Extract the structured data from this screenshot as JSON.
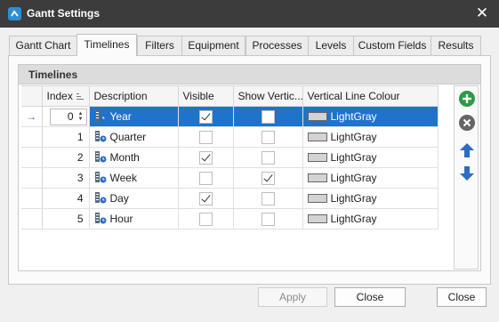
{
  "window": {
    "title": "Gantt Settings",
    "close_glyph": "✕",
    "accent_color": "#3c3c3c"
  },
  "tabs": [
    {
      "label": "Gantt Chart"
    },
    {
      "label": "Timelines"
    },
    {
      "label": "Filters"
    },
    {
      "label": "Equipment"
    },
    {
      "label": "Processes"
    },
    {
      "label": "Levels"
    },
    {
      "label": "Custom Fields"
    },
    {
      "label": "Results"
    }
  ],
  "group": {
    "title": "Timelines"
  },
  "grid": {
    "columns": [
      "Index",
      "Description",
      "Visible",
      "Show Vertic...",
      "Vertical Line Colour"
    ],
    "selection_color": "#1f73c9",
    "row_indicator": "→",
    "rows": [
      {
        "index": "0",
        "description": "Year",
        "visible": true,
        "show_vertical": false,
        "colour": "LightGray"
      },
      {
        "index": "1",
        "description": "Quarter",
        "visible": false,
        "show_vertical": false,
        "colour": "LightGray"
      },
      {
        "index": "2",
        "description": "Month",
        "visible": true,
        "show_vertical": false,
        "colour": "LightGray"
      },
      {
        "index": "3",
        "description": "Week",
        "visible": false,
        "show_vertical": true,
        "colour": "LightGray"
      },
      {
        "index": "4",
        "description": "Day",
        "visible": true,
        "show_vertical": false,
        "colour": "LightGray"
      },
      {
        "index": "5",
        "description": "Hour",
        "visible": false,
        "show_vertical": false,
        "colour": "LightGray"
      }
    ]
  },
  "side_buttons": [
    {
      "icon": "add-icon",
      "color": "#2e9a45"
    },
    {
      "icon": "remove-icon",
      "color": "#666666"
    },
    {
      "icon": "move-up-icon",
      "color": "#2b6cc4"
    },
    {
      "icon": "move-down-icon",
      "color": "#2b6cc4"
    }
  ],
  "footer": {
    "apply_label": "Apply",
    "close_label": "Close",
    "close2_label": "Close"
  }
}
